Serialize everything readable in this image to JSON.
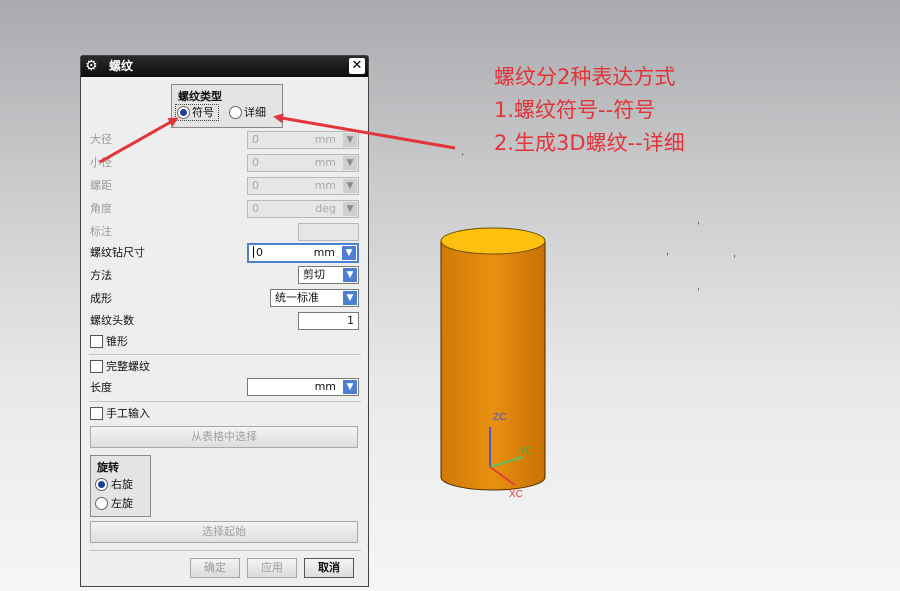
{
  "dialog": {
    "title": "螺纹",
    "close_glyph": "✕",
    "thread_type": {
      "title": "螺纹类型",
      "options": [
        "符号",
        "详细"
      ],
      "selected": "符号"
    },
    "fields": {
      "major_dia": {
        "label": "大径",
        "value": "0",
        "unit": "mm"
      },
      "minor_dia": {
        "label": "小径",
        "value": "0",
        "unit": "mm"
      },
      "pitch": {
        "label": "螺距",
        "value": "0",
        "unit": "mm"
      },
      "angle": {
        "label": "角度",
        "value": "0",
        "unit": "deg"
      },
      "callout": {
        "label": "标注",
        "value": ""
      },
      "tap_drill": {
        "label": "螺纹钻尺寸",
        "value": "0",
        "unit": "mm"
      },
      "method": {
        "label": "方法",
        "value": "剪切"
      },
      "form": {
        "label": "成形",
        "value": "统一标准"
      },
      "starts": {
        "label": "螺纹头数",
        "value": "1"
      },
      "tapered": {
        "label": "锥形"
      },
      "full_thread": {
        "label": "完整螺纹"
      },
      "length": {
        "label": "长度",
        "value": "",
        "unit": "mm"
      },
      "manual": {
        "label": "手工输入"
      },
      "from_table": {
        "label": "从表格中选择"
      }
    },
    "rotation": {
      "title": "旋转",
      "options": [
        "右旋",
        "左旋"
      ],
      "selected": "右旋"
    },
    "select_start": "选择起始",
    "buttons": {
      "ok": "确定",
      "apply": "应用",
      "cancel": "取消"
    }
  },
  "annotation": {
    "lines": [
      "螺纹分2种表达方式",
      "1.螺纹符号--符号",
      "2.生成3D螺纹--详细"
    ],
    "color": "#e2343a"
  },
  "model": {
    "body_color": "#e58a0d",
    "top_color": "#ffc010",
    "axes": {
      "z": "ZC",
      "y": "YC",
      "x": "XC"
    }
  }
}
